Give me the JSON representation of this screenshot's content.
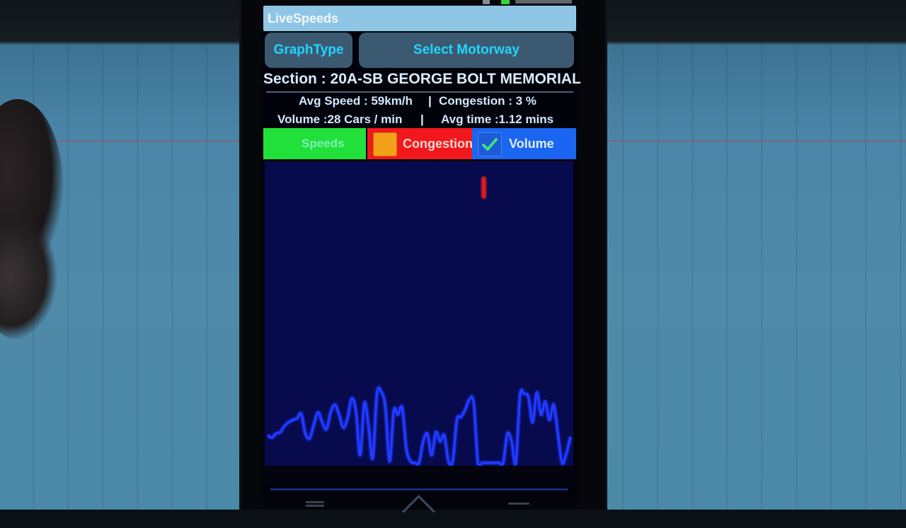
{
  "app": {
    "title": "LiveSpeeds"
  },
  "toolbar": {
    "graph_type_label": "GraphType",
    "select_motorway_label": "Select Motorway"
  },
  "section": {
    "label": "Section : 20A-SB GEORGE BOLT MEMORIAL"
  },
  "stats": {
    "avg_speed": "Avg Speed : 59km/h",
    "congestion": "Congestion : 3 %",
    "volume": "Volume :28 Cars / min",
    "avg_time": "Avg time :1.12 mins",
    "separator": "|"
  },
  "legend": {
    "items": [
      {
        "label": "Speeds",
        "color": "#22e03a",
        "checked": null
      },
      {
        "label": "Congestion",
        "color": "#f2171c",
        "checked": false
      },
      {
        "label": "Volume",
        "color": "#1b66f0",
        "checked": true
      }
    ]
  },
  "colors": {
    "title_bar": "#8fc6e6",
    "button_bg": "#3b5a72",
    "button_text": "#22d4ff",
    "graph_bg": "#080a4e",
    "volume_line": "#1f3cff",
    "checkmark": "#3fe07a"
  },
  "chart_data": {
    "type": "line",
    "title": "",
    "xlabel": "",
    "ylabel": "",
    "grid": false,
    "legend": "top",
    "ylim": [
      0,
      100
    ],
    "series": [
      {
        "name": "Volume",
        "color": "#1f3cff",
        "values": [
          38,
          35,
          40,
          42,
          50,
          55,
          58,
          60,
          66,
          40,
          34,
          52,
          68,
          55,
          46,
          68,
          78,
          65,
          48,
          60,
          86,
          70,
          12,
          80,
          50,
          8,
          92,
          95,
          75,
          4,
          70,
          65,
          74,
          20,
          4,
          2,
          2,
          30,
          40,
          12,
          42,
          30,
          38,
          4,
          4,
          58,
          62,
          72,
          85,
          80,
          2,
          2,
          2,
          2,
          2,
          2,
          2,
          40,
          30,
          2,
          90,
          92,
          88,
          55,
          94,
          65,
          82,
          58,
          78,
          40,
          2,
          14,
          36
        ]
      },
      {
        "name": "Congestion",
        "color": "#e01c1c",
        "values": [],
        "note_marker": "single red mark near top of chart"
      }
    ]
  }
}
